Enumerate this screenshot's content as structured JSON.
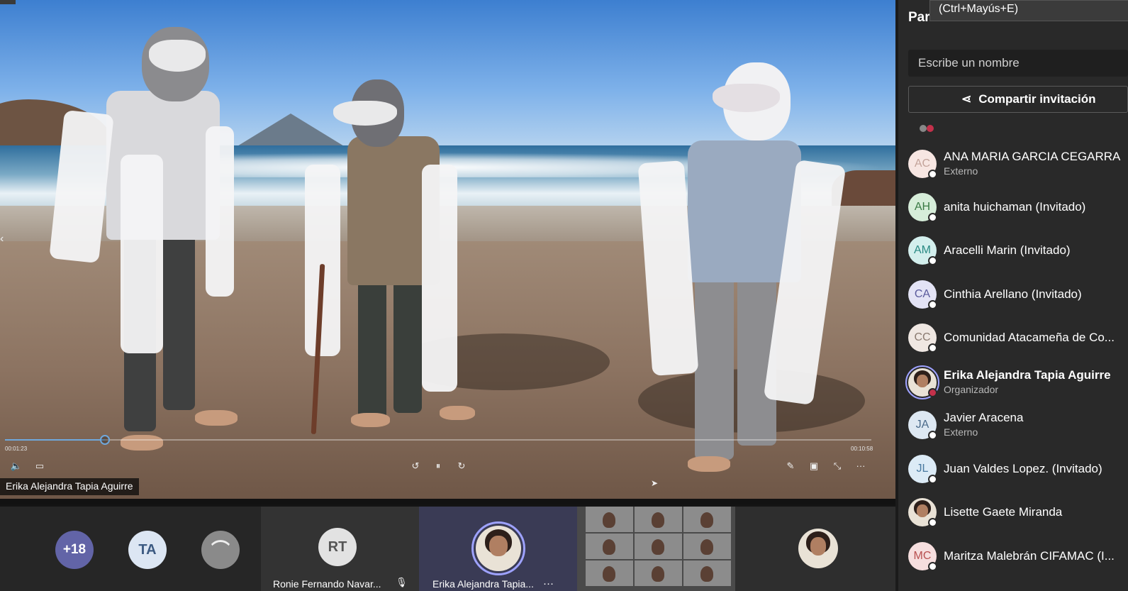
{
  "video": {
    "presenter_name": "Erika Alejandra Tapia Aguirre",
    "time_elapsed": "00:01:23",
    "time_total": "00:10:58",
    "progress_fraction": 0.115
  },
  "gallery": {
    "overflow_count": "+18",
    "tile_ta": "TA",
    "tile_rt_initials": "RT",
    "tile_rt_name": "Ronie Fernando Navar...",
    "tile_erika_name": "Erika Alejandra Tapia...",
    "more_dots": "···"
  },
  "panel": {
    "title": "Par",
    "tooltip": "(Ctrl+Mayús+E)",
    "search_placeholder": "Escribe un nombre",
    "invite_label": "Compartir invitación",
    "participants": [
      {
        "initials": "AC",
        "name": "ANA MARIA GARCIA CEGARRA",
        "role": "Externo",
        "color": "#c3a39a",
        "bg": "#f7e6e2"
      },
      {
        "initials": "AH",
        "name": "anita huichaman (Invitado)",
        "role": "",
        "color": "#3a7a45",
        "bg": "#d6edd9"
      },
      {
        "initials": "AM",
        "name": "Aracelli Marin (Invitado)",
        "role": "",
        "color": "#2a8a84",
        "bg": "#d3efed"
      },
      {
        "initials": "CA",
        "name": "Cinthia Arellano (Invitado)",
        "role": "",
        "color": "#5a5a9c",
        "bg": "#e3e3f5"
      },
      {
        "initials": "CC",
        "name": "Comunidad Atacameña de Co...",
        "role": "",
        "color": "#8a7a70",
        "bg": "#efe7e2"
      },
      {
        "initials": "",
        "name": "Erika Alejandra Tapia Aguirre",
        "role": "Organizador",
        "color": "",
        "bg": ""
      },
      {
        "initials": "JA",
        "name": "Javier Aracena",
        "role": "Externo",
        "color": "#4a6a8a",
        "bg": "#dde8f2"
      },
      {
        "initials": "JL",
        "name": "Juan Valdes Lopez. (Invitado)",
        "role": "",
        "color": "#4a7aa0",
        "bg": "#dcebf6"
      },
      {
        "initials": "",
        "name": "Lisette Gaete Miranda",
        "role": "",
        "color": "",
        "bg": ""
      },
      {
        "initials": "MC",
        "name": "Maritza Malebrán CIFAMAC (I...",
        "role": "",
        "color": "#b85050",
        "bg": "#f6dede"
      }
    ]
  }
}
